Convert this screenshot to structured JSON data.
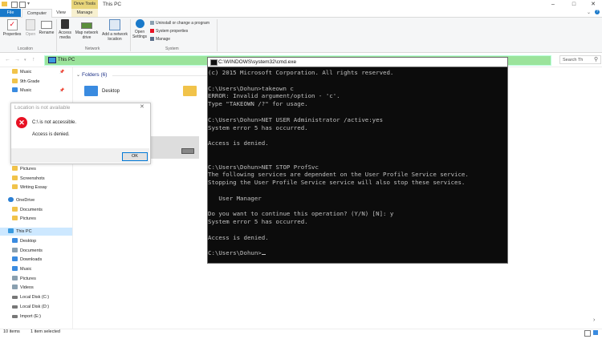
{
  "window": {
    "title": "This PC",
    "context_tab": "Drive Tools",
    "controls": [
      "–",
      "□",
      "✕"
    ]
  },
  "tabs": [
    {
      "label": "File"
    },
    {
      "label": "Computer"
    },
    {
      "label": "View"
    },
    {
      "label": "Manage"
    }
  ],
  "ribbon": {
    "location": {
      "properties": "Properties",
      "open": "Open",
      "rename": "Rename",
      "group": "Location"
    },
    "network": {
      "access_media": "Access media",
      "map_drive": "Map network drive",
      "add_location": "Add a network location",
      "group": "Network"
    },
    "system": {
      "open_settings": "Open Settings",
      "uninstall": "Uninstall or change a program",
      "system_properties": "System properties",
      "manage": "Manage",
      "group": "System"
    }
  },
  "address": {
    "path": "This PC",
    "search_placeholder": "Search Th"
  },
  "nav_pane": {
    "items": [
      {
        "label": "Music",
        "color": "#f1c34a",
        "pinned": true
      },
      {
        "label": "9th Grade",
        "color": "#f1c34a",
        "pinned": false
      },
      {
        "label": "Music",
        "color": "#3a8be0",
        "pinned": true
      },
      {
        "label": "Pictures",
        "color": "#f1c34a"
      },
      {
        "label": "Screenshots",
        "color": "#f1c34a"
      },
      {
        "label": "Writing Essay",
        "color": "#f1c34a"
      },
      {
        "label": "OneDrive",
        "color": "#2a7fd4"
      },
      {
        "label": "Documents",
        "color": "#f1c34a"
      },
      {
        "label": "Pictures",
        "color": "#f1c34a"
      },
      {
        "label": "This PC",
        "color": "#3a9be0"
      },
      {
        "label": "Desktop",
        "color": "#3a8be0"
      },
      {
        "label": "Documents",
        "color": "#8aa0b0"
      },
      {
        "label": "Downloads",
        "color": "#3a8be0"
      },
      {
        "label": "Music",
        "color": "#3a8be0"
      },
      {
        "label": "Pictures",
        "color": "#8aa0b0"
      },
      {
        "label": "Videos",
        "color": "#8aa0b0"
      },
      {
        "label": "Local Disk (C:)",
        "color": "#777777"
      },
      {
        "label": "Local Disk (D:)",
        "color": "#777777"
      },
      {
        "label": "Import (E:)",
        "color": "#777777"
      }
    ]
  },
  "content": {
    "folders_header": "Folders (6)",
    "folder_desktop": "Desktop"
  },
  "status_bar": {
    "items": "10 items",
    "selected": "1 item selected"
  },
  "error_dialog": {
    "title": "Location is not available",
    "message": "C:\\ is not accessible.",
    "detail": "Access is denied.",
    "ok": "OK"
  },
  "cmd": {
    "title": "C:\\WINDOWS\\system32\\cmd.exe",
    "output": "(c) 2015 Microsoft Corporation. All rights reserved.\n\nC:\\Users\\Dohun>takeown c\nERROR: Invalid argument/option - 'c'.\nType \"TAKEOWN /?\" for usage.\n\nC:\\Users\\Dohun>NET USER Administrator /active:yes\nSystem error 5 has occurred.\n\nAccess is denied.\n\n\nC:\\Users\\Dohun>NET STOP ProfSvc\nThe following services are dependent on the User Profile Service service.\nStopping the User Profile Service service will also stop these services.\n\n   User Manager\n\nDo you want to continue this operation? (Y/N) [N]: y\nSystem error 5 has occurred.\n\nAccess is denied.\n\n",
    "prompt": "C:\\Users\\Dohun>"
  }
}
